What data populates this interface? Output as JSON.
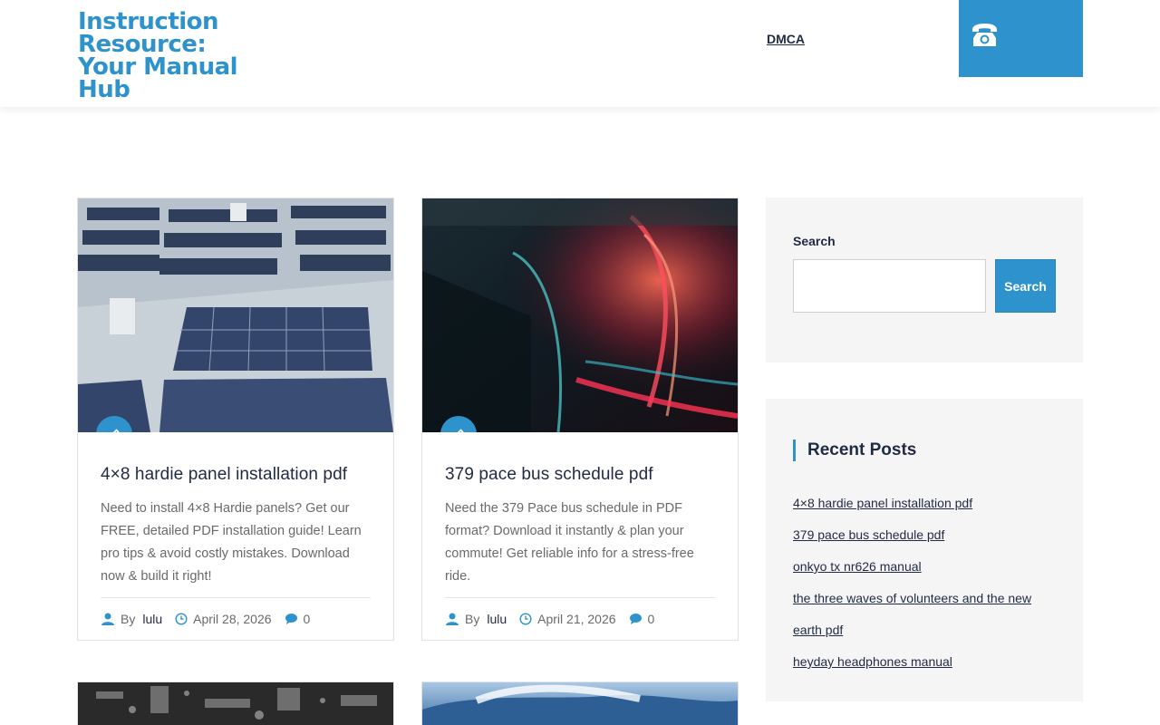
{
  "header": {
    "site_title": "Instruction Resource: Your Manual Hub",
    "nav_item": "DMCA",
    "phone_icon": "phone-icon"
  },
  "posts": [
    {
      "title": "4×8 hardie panel installation pdf",
      "excerpt": "Need to install 4×8 Hardie panels? Get our FREE, detailed PDF installation guide! Learn pro tips & avoid costly mistakes. Download now & build it right!",
      "by": "By",
      "author": "lulu",
      "date": "April 28, 2026",
      "comments": "0"
    },
    {
      "title": "379 pace bus schedule pdf",
      "excerpt": "Need the 379 Pace bus schedule in PDF format? Download it instantly & plan your commute! Get reliable info for a stress-free ride.",
      "by": "By",
      "author": "lulu",
      "date": "April 21, 2026",
      "comments": "0"
    }
  ],
  "sidebar": {
    "search_label": "Search",
    "search_button": "Search",
    "recent_title": "Recent Posts",
    "recent_posts": [
      "4×8 hardie panel installation pdf",
      "379 pace bus schedule pdf",
      "onkyo tx nr626 manual",
      "the three waves of volunteers and the new earth pdf",
      "heyday headphones manual"
    ]
  },
  "colors": {
    "accent": "#2e93cc",
    "heading": "#1f2a44",
    "text_muted": "#6a6a6a",
    "widget_bg": "#f5f5f5"
  }
}
